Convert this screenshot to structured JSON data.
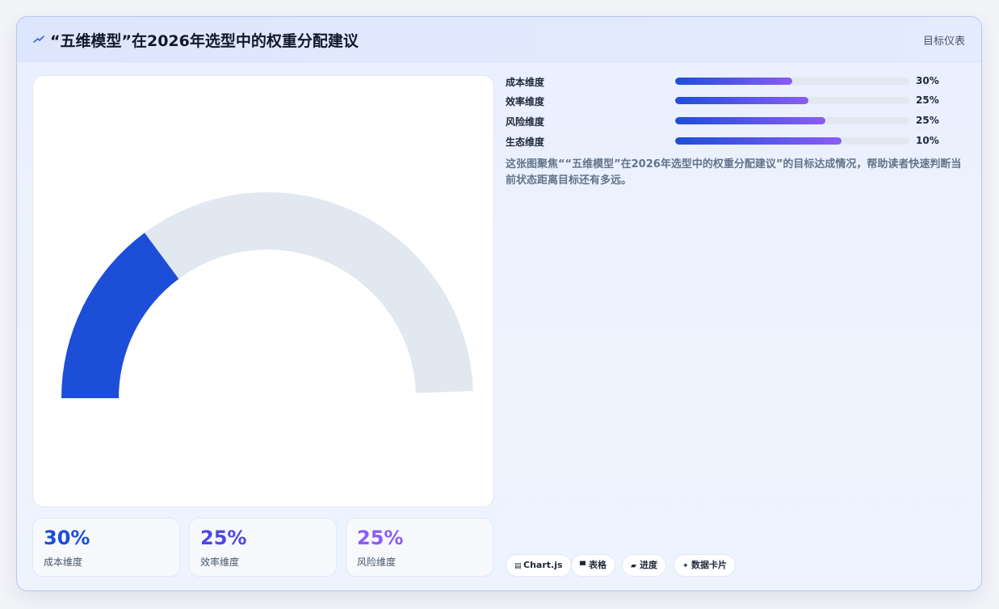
{
  "header": {
    "title": "“五维模型”在2026年选型中的权重分配建议",
    "kind_label": "目标仪表"
  },
  "chart_data": {
    "type": "gauge",
    "value_percent": 30,
    "min": 0,
    "max": 100,
    "colors": {
      "value": "#1d4ed8",
      "track": "#e2e8f0"
    },
    "dimensions": [
      {
        "label": "成本维度",
        "value": 30,
        "display": "30%"
      },
      {
        "label": "效率维度",
        "value": 25,
        "display": "25%"
      },
      {
        "label": "风险维度",
        "value": 25,
        "display": "25%"
      },
      {
        "label": "生态维度",
        "value": 10,
        "display": "10%"
      }
    ]
  },
  "bar_fills": [
    0.5,
    0.57,
    0.64,
    0.71
  ],
  "stats": [
    {
      "value": "30%",
      "label": "成本维度",
      "color": "#1d4ed8"
    },
    {
      "value": "25%",
      "label": "效率维度",
      "color": "#4f46e5"
    },
    {
      "value": "25%",
      "label": "风险维度",
      "color": "#8b5cf6"
    }
  ],
  "description": "这张图聚焦““五维模型”在2026年选型中的权重分配建议”的目标达成情况，帮助读者快速判断当前状态距离目标还有多远。",
  "chips": [
    {
      "icon": "chart-icon",
      "label": "Chart.js"
    },
    {
      "icon": "table-icon",
      "label": "表格"
    },
    {
      "icon": "progress-icon",
      "label": "进度"
    },
    {
      "icon": "data-card-icon",
      "label": "数据卡片"
    }
  ]
}
